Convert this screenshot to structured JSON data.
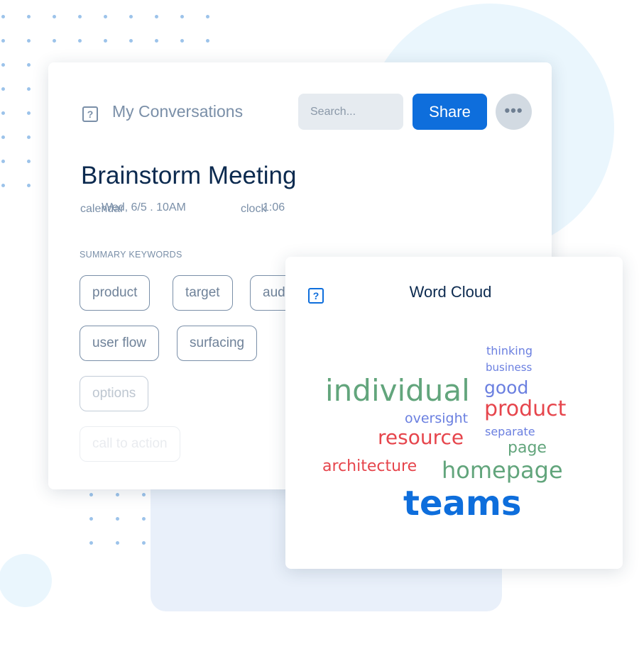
{
  "main_card": {
    "icon": "help-square-icon",
    "title": "My Conversations",
    "search": {
      "placeholder": "Search...",
      "value": ""
    },
    "share_label": "Share",
    "more_label": "•••",
    "heading": "Brainstorm Meeting",
    "date_icon_text": "calendar",
    "date": "Wed, 6/5 . 10AM",
    "duration_icon_text": "clock",
    "duration": "1:06",
    "keywords_label": "SUMMARY KEYWORDS",
    "keywords": [
      "product",
      "target",
      "aud",
      "user flow",
      "surfacing",
      "options",
      "call to action"
    ]
  },
  "word_cloud": {
    "icon": "help-square-icon",
    "title": "Word Cloud",
    "words": [
      "thinking",
      "business",
      "individual",
      "good",
      "product",
      "oversight",
      "resource",
      "separate",
      "page",
      "architecture",
      "homepage",
      "teams"
    ]
  },
  "colors": {
    "accent": "#0e6edc",
    "green": "#62a57c",
    "red": "#e6454c",
    "blue": "#6a7fe0",
    "text": "#7a8fa8"
  }
}
